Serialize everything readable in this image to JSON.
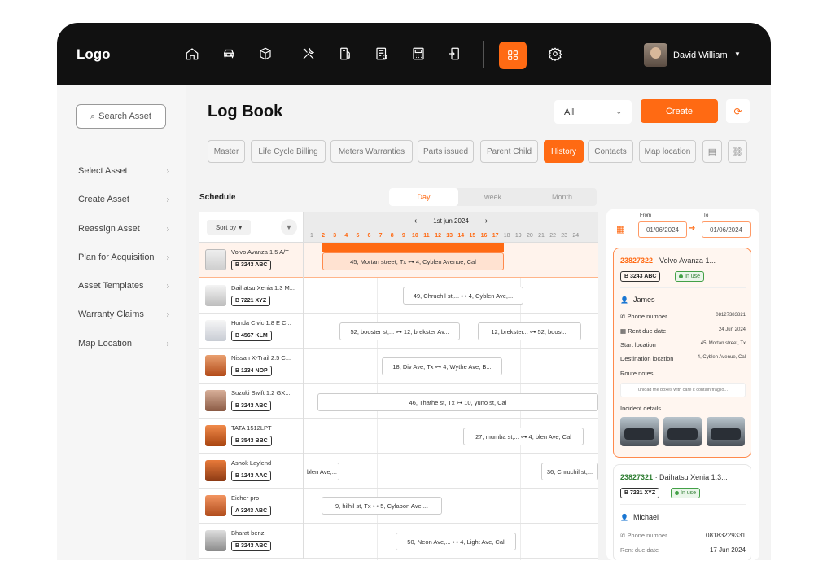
{
  "header": {
    "logo": "Logo",
    "user_name": "David William",
    "nav_icons": [
      "home-icon",
      "car-icon",
      "box-icon",
      "tools-icon",
      "fuel-icon",
      "report-icon",
      "calculator-icon",
      "exit-icon",
      "grid-icon",
      "settings-icon"
    ]
  },
  "sidebar": {
    "search_placeholder": "Search Asset",
    "items": [
      {
        "label": "Select Asset"
      },
      {
        "label": "Create Asset"
      },
      {
        "label": "Reassign Asset"
      },
      {
        "label": "Plan for Acquisition"
      },
      {
        "label": "Asset Templates"
      },
      {
        "label": "Warranty Claims"
      },
      {
        "label": "Map Location"
      }
    ]
  },
  "main": {
    "title": "Log Book",
    "filter_value": "All",
    "create_label": "Create",
    "tabs": [
      "Master",
      "Life Cycle Billing",
      "Meters Warranties",
      "Parts issued",
      "Parent Child",
      "History",
      "Contacts",
      "Map location"
    ],
    "active_tab": "History"
  },
  "schedule": {
    "title": "Schedule",
    "views": [
      "Day",
      "week",
      "Month"
    ],
    "active_view": "Day",
    "sort_label": "Sort by",
    "date": "1st jun 2024",
    "hours": [
      "1",
      "2",
      "3",
      "4",
      "5",
      "6",
      "7",
      "8",
      "9",
      "10",
      "11",
      "12",
      "13",
      "14",
      "15",
      "16",
      "17",
      "18",
      "19",
      "20",
      "21",
      "22",
      "23",
      "24"
    ],
    "assets": [
      {
        "name": "Volvo Avanza 1.5 A/T",
        "plate": "B 3243 ABC"
      },
      {
        "name": "Daihatsu Xenia 1.3 M...",
        "plate": "B 7221 XYZ"
      },
      {
        "name": "Honda Civic 1.8 E C...",
        "plate": "B 4567 KLM"
      },
      {
        "name": "Nissan X-Trail 2.5 C...",
        "plate": "B 1234 NOP"
      },
      {
        "name": "Suzuki Swift 1.2 GX...",
        "plate": "B 3243 ABC"
      },
      {
        "name": "TATA 1512LPT",
        "plate": "B 3543 BBC"
      },
      {
        "name": "Ashok Laylend",
        "plate": "B 1243 AAC"
      },
      {
        "name": "Eicher pro",
        "plate": "A 3243 ABC"
      },
      {
        "name": "Bharat benz",
        "plate": "B 3243 ABC"
      }
    ],
    "bookings": [
      {
        "row": 0,
        "text": "45, Mortan street, Tx  ⊶  4, Cyblen Avenue, Cal"
      },
      {
        "row": 1,
        "text": "49, Chruchil st,...  ⊶  4, Cyblen Ave,..."
      },
      {
        "row": 2,
        "text": "52, booster st,...  ⊶  12, brekster Av..."
      },
      {
        "row": 2,
        "text": "12, brekster...  ⊶  52, boost..."
      },
      {
        "row": 3,
        "text": "18, Div Ave, Tx  ⊶  4, Wythe Ave, B..."
      },
      {
        "row": 4,
        "text": "46, Thathe st, Tx  ⊶  10, yuno st, Cal"
      },
      {
        "row": 5,
        "text": "27, mumba st,...  ⊶  4, blen Ave, Cal"
      },
      {
        "row": 6,
        "text": "blen Ave,..."
      },
      {
        "row": 6,
        "text": "36, Chruchil st,..."
      },
      {
        "row": 7,
        "text": "9, hilhil st, Tx  ⊶  5, Cylabon Ave,..."
      },
      {
        "row": 8,
        "text": "50, Neon Ave,...  ⊶  4, Light Ave, Cal"
      }
    ]
  },
  "details": {
    "from_label": "From",
    "to_label": "To",
    "from_date": "01/06/2024",
    "to_date": "01/06/2024",
    "cards": [
      {
        "id": "23827322",
        "vehicle": "· Volvo Avanza 1...",
        "plate": "B 3243 ABC",
        "status": "In use",
        "driver": "James",
        "phone_label": "Phone number",
        "phone": "08127383821",
        "rent_label": "Rent due date",
        "rent_date": "24 Jun 2024",
        "start_label": "Start location",
        "start": "45, Mortan street, Tx",
        "dest_label": "Destination location",
        "dest": "4, Cyblen Avenue, Cal",
        "notes_label": "Route notes",
        "notes": "unload the boxes with care it contain fragilo...",
        "incident_label": "Incident details"
      },
      {
        "id": "23827321",
        "vehicle": "· Daihatsu Xenia 1.3...",
        "plate": "B 7221 XYZ",
        "status": "In use",
        "driver": "Michael",
        "phone_label": "Phone number",
        "phone": "08183229331",
        "rent_label": "Rent due date",
        "rent_date": "17 Jun 2024"
      }
    ]
  },
  "colors": {
    "accent": "#ff6a13",
    "topbar": "#111111",
    "in_use": "#43a047"
  }
}
